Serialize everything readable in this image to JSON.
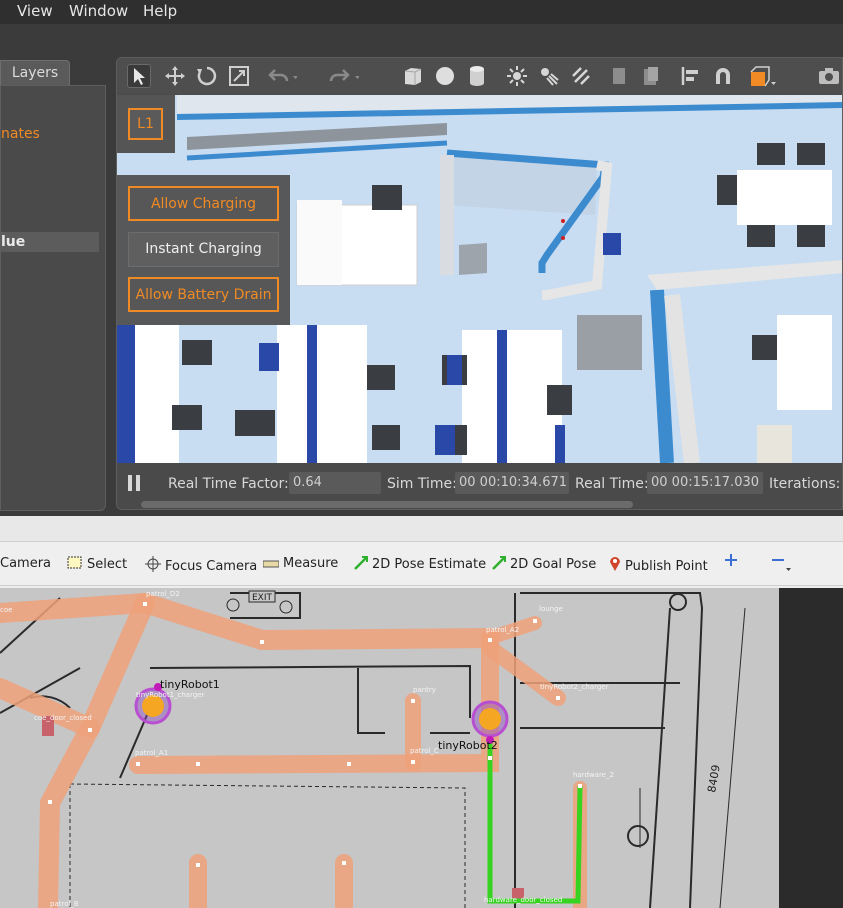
{
  "menu": {
    "items": [
      "View",
      "Window",
      "Help"
    ]
  },
  "layers": {
    "tab_label": "Layers",
    "coords_fragment": "nates",
    "value_fragment": "lue"
  },
  "viewport": {
    "layer_badge": "L1",
    "buttons": {
      "allow_charging": "Allow Charging",
      "instant_charging": "Instant Charging",
      "allow_battery_drain": "Allow Battery Drain"
    }
  },
  "status": {
    "real_time_factor_label": "Real Time Factor:",
    "real_time_factor": "0.64",
    "sim_time_label": "Sim Time:",
    "sim_time": "00 00:10:34.671",
    "real_time_label": "Real Time:",
    "real_time": "00 00:15:17.030",
    "iterations_label": "Iterations:"
  },
  "rviz_tools": {
    "camera": "Camera",
    "select": "Select",
    "focus_camera": "Focus Camera",
    "measure": "Measure",
    "pose_estimate": "2D Pose Estimate",
    "goal_pose": "2D Goal Pose",
    "publish_point": "Publish Point"
  },
  "map": {
    "robots": [
      "tinyRobot1",
      "tinyRobot2"
    ],
    "waypoints": [
      "patrol_D2",
      "patrol_A2",
      "lounge",
      "pantry",
      "tinyRobot2_charger",
      "patrol_A1",
      "patrol_C",
      "hardware_2",
      "patrol_B",
      "coe",
      "tinyRobot1_charger",
      "hardware_door_closed",
      "coe_door_closed"
    ],
    "exit_sign": "EXIT",
    "dimension_text": "8409"
  },
  "colors": {
    "accent_orange": "#f08a24",
    "lane": "#e8a179",
    "path_green": "#36d420",
    "robot_fill": "#f5a623",
    "robot_ring": "#b84fd1"
  }
}
